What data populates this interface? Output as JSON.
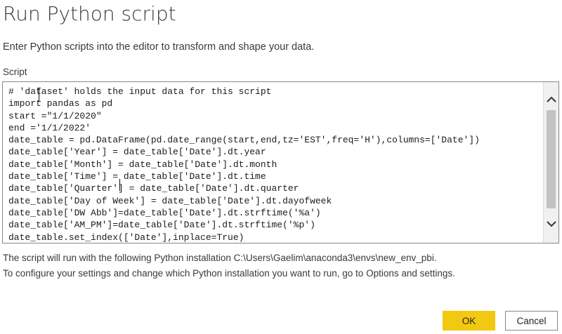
{
  "dialog": {
    "title": "Run Python script",
    "description": "Enter Python scripts into the editor to transform and shape your data.",
    "script_label": "Script"
  },
  "editor": {
    "lines": [
      "# 'dataset' holds the input data for this script",
      "import pandas as pd",
      "start =\"1/1/2020\"",
      "end ='1/1/2022'",
      "date_table = pd.DataFrame(pd.date_range(start,end,tz='EST',freq='H'),columns=['Date'])",
      "date_table['Year'] = date_table['Date'].dt.year",
      "date_table['Month'] = date_table['Date'].dt.month",
      "date_table['Time'] = date_table['Date'].dt.time",
      "date_table['Quarter'] = date_table['Date'].dt.quarter",
      "date_table['Day of Week'] = date_table['Date'].dt.dayofweek",
      "date_table['DW Abb']=date_table['Date'].dt.strftime('%a')",
      "date_table['AM_PM']=date_table['Date'].dt.strftime('%p')",
      "date_table.set_index(['Date'],inplace=True)"
    ],
    "scroll_up_icon": "chevron-up",
    "scroll_down_icon": "chevron-down"
  },
  "footer": {
    "installation_text": "The script will run with the following Python installation C:\\Users\\Gaelim\\anaconda3\\envs\\new_env_pbi.",
    "configure_text": "To configure your settings and change which Python installation you want to run, go to Options and settings."
  },
  "buttons": {
    "ok_label": "OK",
    "cancel_label": "Cancel"
  },
  "colors": {
    "ok_button": "#f2c811",
    "text": "#3b3a39"
  }
}
